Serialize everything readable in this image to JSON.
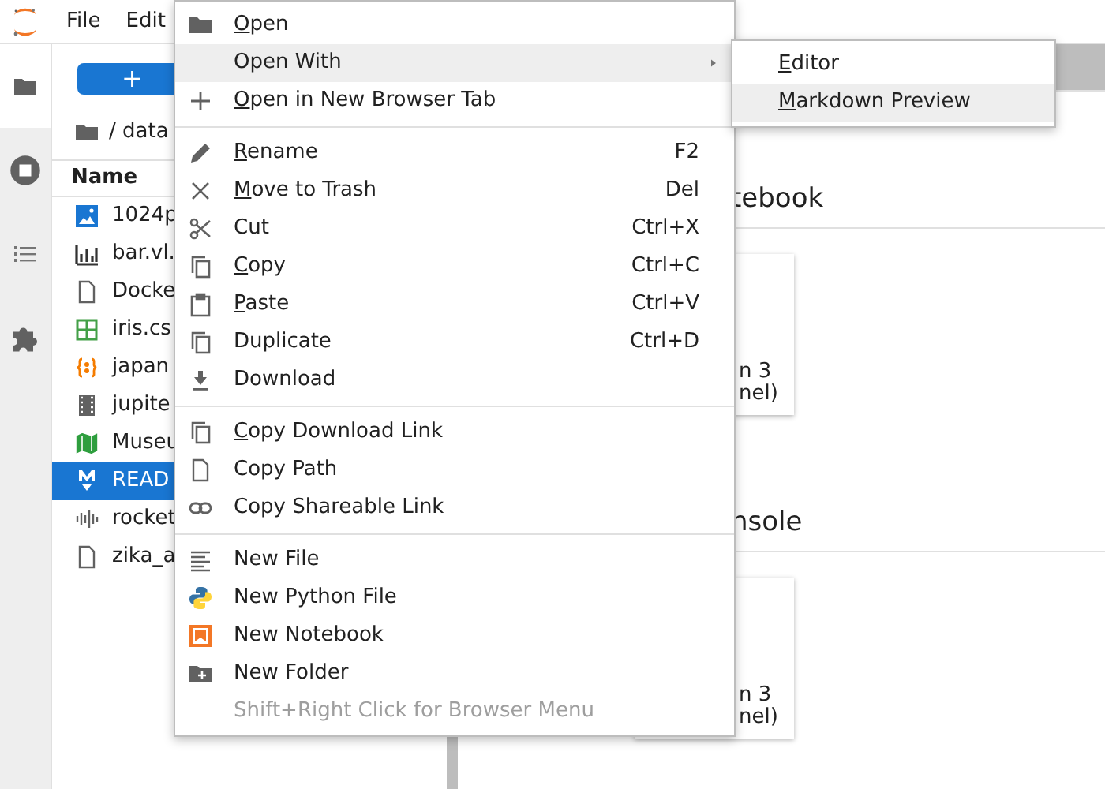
{
  "menubar": {
    "items": [
      {
        "label": "File"
      },
      {
        "label": "Edit"
      }
    ]
  },
  "sidebar_tabs": [
    {
      "selected": true
    },
    {
      "selected": false
    },
    {
      "selected": false
    },
    {
      "selected": false
    }
  ],
  "file_browser": {
    "new_button": "+",
    "path": "/ data",
    "column_header": "Name",
    "files": [
      {
        "name": "1024p",
        "selected": false
      },
      {
        "name": "bar.vl.",
        "selected": false
      },
      {
        "name": "Docke",
        "selected": false
      },
      {
        "name": "iris.cs",
        "selected": false
      },
      {
        "name": "japan",
        "selected": false
      },
      {
        "name": "jupite",
        "selected": false
      },
      {
        "name": "Museu",
        "selected": false
      },
      {
        "name": "READ",
        "selected": true
      },
      {
        "name": "rocket",
        "selected": false
      },
      {
        "name": "zika_a",
        "selected": false
      }
    ]
  },
  "launcher": {
    "sections": [
      {
        "title": "tebook",
        "cards": [
          {
            "lines": [
              "n 3",
              "nel)"
            ]
          }
        ]
      },
      {
        "title": "nsole",
        "cards": [
          {
            "lines": [
              "n 3",
              "nel)"
            ]
          }
        ]
      }
    ]
  },
  "context_menu": {
    "groups": [
      [
        {
          "kind": "item",
          "label": "Open",
          "underline_first": true,
          "highlighted": false,
          "disabled": false
        },
        {
          "kind": "submenu",
          "label": "Open With",
          "underline_first": false,
          "highlighted": true,
          "disabled": false
        },
        {
          "kind": "item",
          "label": "Open in New Browser Tab",
          "underline_first": true,
          "highlighted": false,
          "disabled": false
        }
      ],
      [
        {
          "kind": "item",
          "label": "Rename",
          "underline_first": true,
          "shortcut": "F2",
          "highlighted": false,
          "disabled": false
        },
        {
          "kind": "item",
          "label": "Move to Trash",
          "underline_first": true,
          "shortcut": "Del",
          "highlighted": false,
          "disabled": false
        },
        {
          "kind": "item",
          "label": "Cut",
          "underline_first": false,
          "shortcut": "Ctrl+X",
          "highlighted": false,
          "disabled": false
        },
        {
          "kind": "item",
          "label": "Copy",
          "underline_first": true,
          "shortcut": "Ctrl+C",
          "highlighted": false,
          "disabled": false
        },
        {
          "kind": "item",
          "label": "Paste",
          "underline_first": true,
          "shortcut": "Ctrl+V",
          "highlighted": false,
          "disabled": false
        },
        {
          "kind": "item",
          "label": "Duplicate",
          "underline_first": false,
          "shortcut": "Ctrl+D",
          "highlighted": false,
          "disabled": false
        },
        {
          "kind": "item",
          "label": "Download",
          "underline_first": false,
          "highlighted": false,
          "disabled": false
        }
      ],
      [
        {
          "kind": "item",
          "label": "Copy Download Link",
          "underline_first": true,
          "highlighted": false,
          "disabled": false
        },
        {
          "kind": "item",
          "label": "Copy Path",
          "underline_first": false,
          "highlighted": false,
          "disabled": false
        },
        {
          "kind": "item",
          "label": "Copy Shareable Link",
          "underline_first": false,
          "highlighted": false,
          "disabled": false
        }
      ],
      [
        {
          "kind": "item",
          "label": "New File",
          "underline_first": false,
          "highlighted": false,
          "disabled": false
        },
        {
          "kind": "item",
          "label": "New Python File",
          "underline_first": false,
          "highlighted": false,
          "disabled": false
        },
        {
          "kind": "item",
          "label": "New Notebook",
          "underline_first": false,
          "highlighted": false,
          "disabled": false
        },
        {
          "kind": "item",
          "label": "New Folder",
          "underline_first": false,
          "highlighted": false,
          "disabled": false
        },
        {
          "kind": "item",
          "label": "Shift+Right Click for Browser Menu",
          "underline_first": false,
          "highlighted": false,
          "disabled": true
        }
      ]
    ]
  },
  "submenu": {
    "items": [
      {
        "label": "Editor",
        "underline_first": true,
        "highlighted": false
      },
      {
        "label": "Markdown Preview",
        "underline_first": true,
        "highlighted": true
      }
    ]
  }
}
